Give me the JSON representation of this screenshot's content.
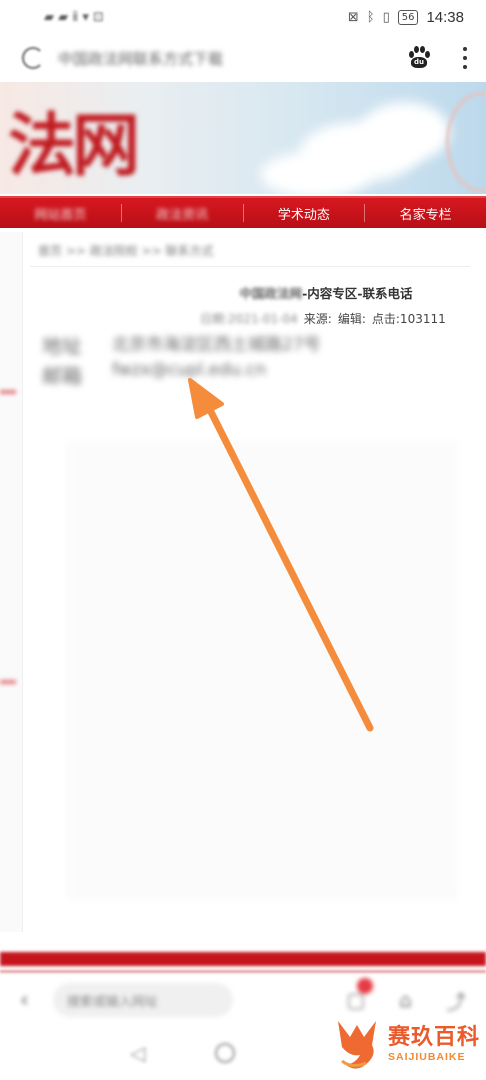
{
  "status_bar": {
    "carrier_text": "▰ ▰ ⅱ ▾ ⊡",
    "battery": "56",
    "time": "14:38"
  },
  "address_bar": {
    "url_text": "中国政法网联系方式下载",
    "baidu_label": "du"
  },
  "banner": {
    "title": "法网"
  },
  "nav": {
    "items": [
      "网站首页",
      "政法资讯",
      "学术动态",
      "名家专栏"
    ]
  },
  "breadcrumb": "首页 >> 政法院校 >> 联系方式",
  "article": {
    "title_blur": "中国政法网",
    "title_clear": "-内容专区-联系电话",
    "meta_blur": "日期:2021-01-04",
    "meta_source": "来源:",
    "meta_editor": "编辑:",
    "meta_clicks": "点击:103111"
  },
  "contact": {
    "address_label": "地址",
    "address_value": "北京市海淀区西土城路27号",
    "email_label": "邮箱",
    "email_value": "fwzx@cupl.edu.cn"
  },
  "toolbar": {
    "back": "‹",
    "search_placeholder": "搜索或输入网址"
  },
  "watermark": {
    "cn": "赛玖百科",
    "en": "SAIJIUBAIKE"
  },
  "colors": {
    "accent_red": "#c5141c",
    "arrow_orange": "#f48c3c"
  }
}
